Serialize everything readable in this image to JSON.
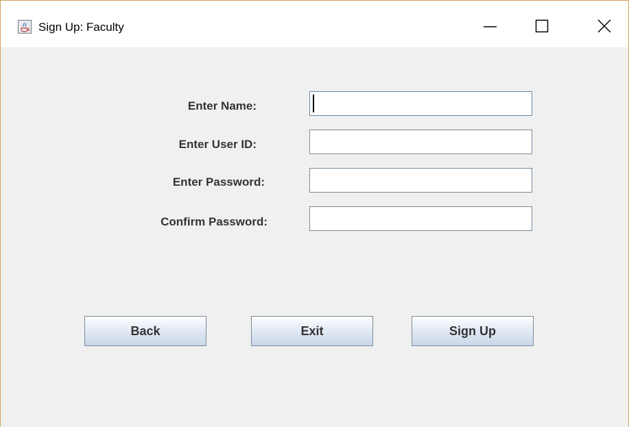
{
  "window": {
    "title": "Sign Up: Faculty",
    "icon": "java-cup-icon",
    "controls": [
      "minimize-icon",
      "maximize-icon",
      "close-icon"
    ]
  },
  "form": {
    "name_label": "Enter Name:",
    "userid_label": "Enter User ID:",
    "password_label": "Enter Password:",
    "confirm_label": "Confirm Password:",
    "name_value": "",
    "userid_value": "",
    "password_value": "",
    "confirm_value": ""
  },
  "buttons": {
    "back_label": "Back",
    "exit_label": "Exit",
    "signup_label": "Sign Up"
  },
  "colors": {
    "window_border": "#d4a15a",
    "background": "#f0f0f0",
    "label_text": "#333333"
  }
}
